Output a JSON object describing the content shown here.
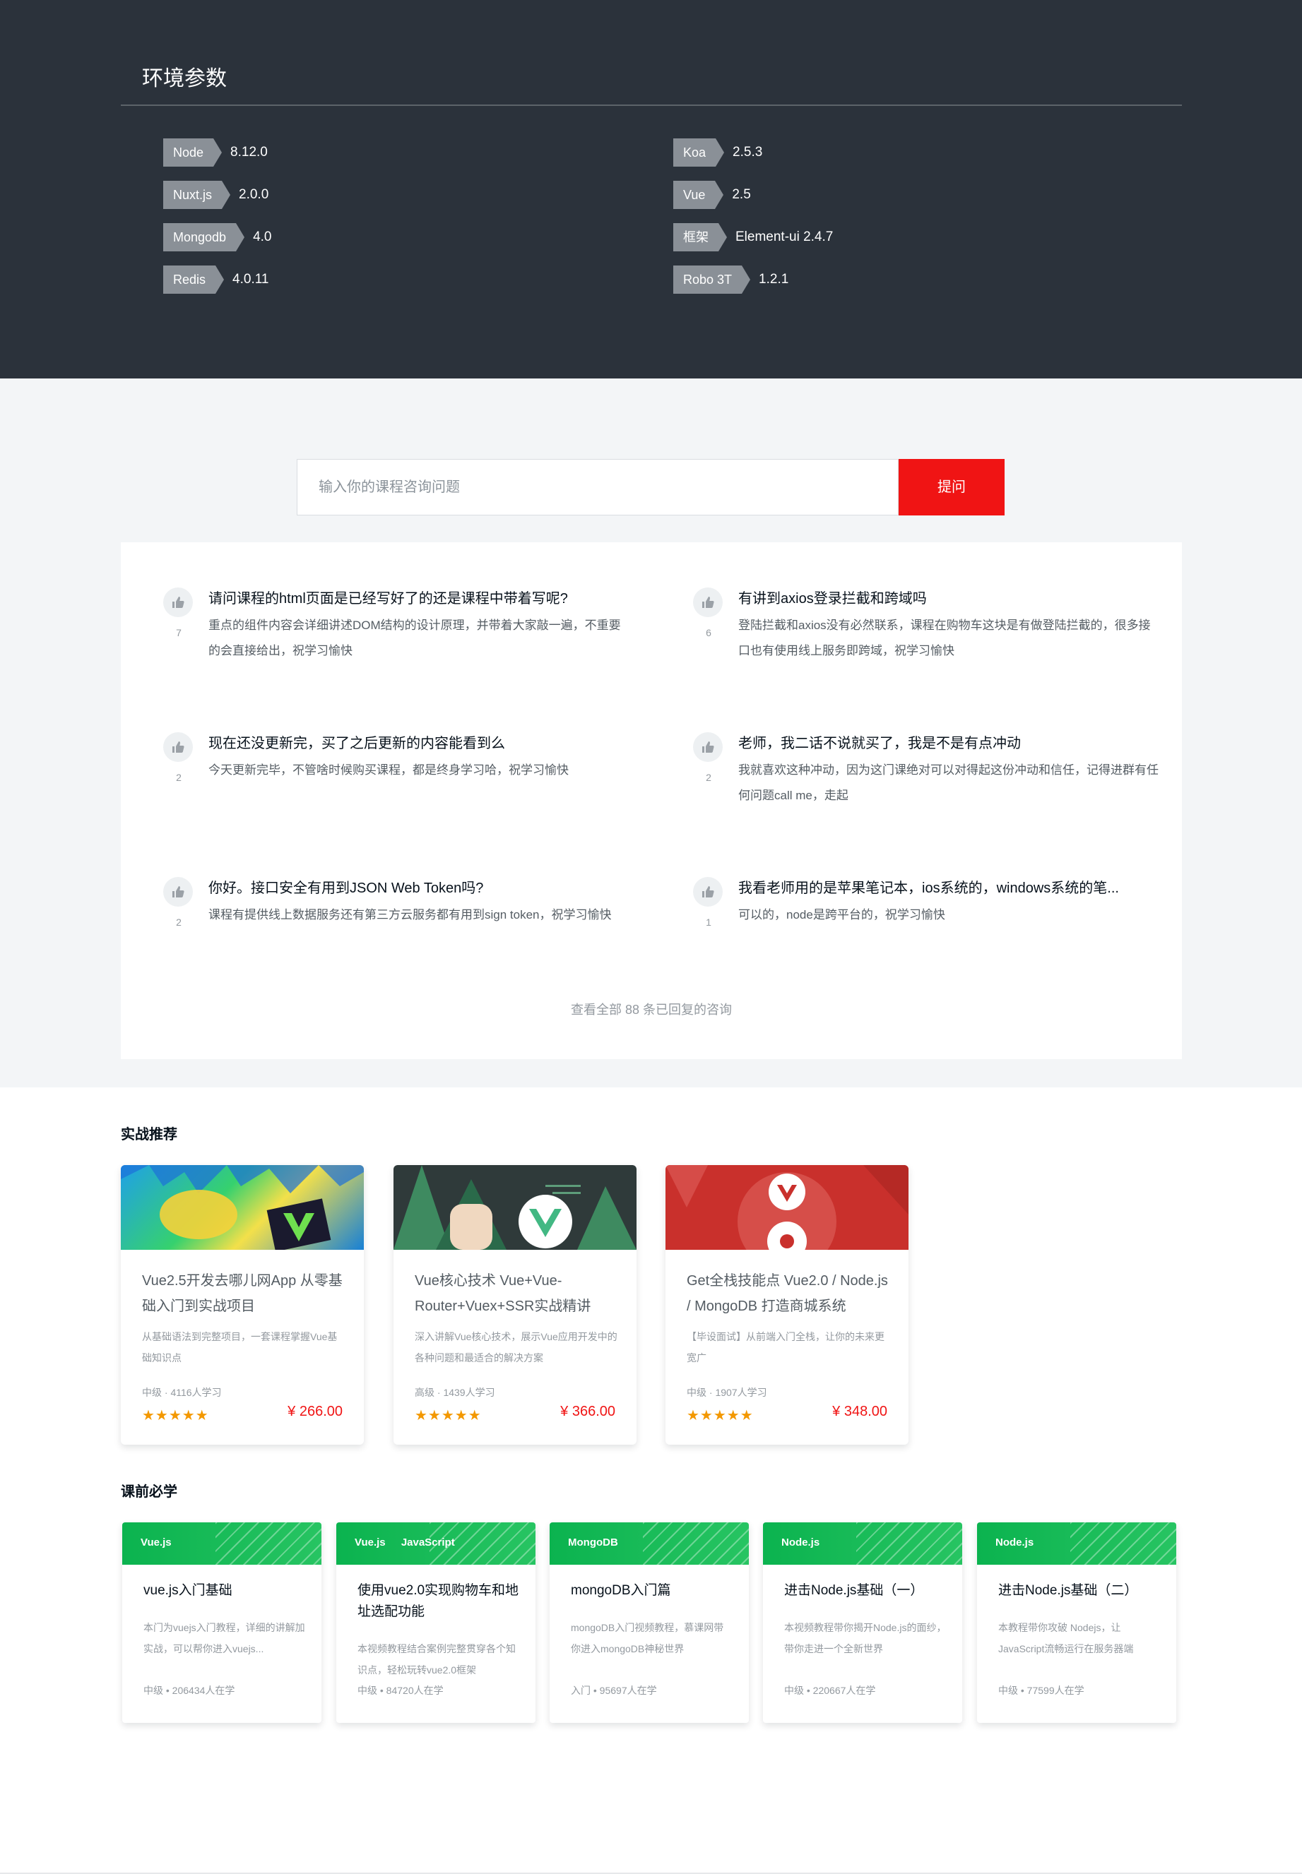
{
  "env": {
    "title": "环境参数",
    "left": [
      {
        "name": "Node",
        "value": "8.12.0"
      },
      {
        "name": "Nuxt.js",
        "value": "2.0.0"
      },
      {
        "name": "Mongodb",
        "value": "4.0"
      },
      {
        "name": "Redis",
        "value": "4.0.11"
      }
    ],
    "right": [
      {
        "name": "Koa",
        "value": "2.5.3"
      },
      {
        "name": "Vue",
        "value": "2.5"
      },
      {
        "name": "框架",
        "value": "Element-ui 2.4.7"
      },
      {
        "name": "Robo 3T",
        "value": "1.2.1"
      }
    ]
  },
  "ask": {
    "placeholder": "输入你的课程咨询问题",
    "button": "提问"
  },
  "qa": {
    "items": [
      {
        "likes": "7",
        "question": "请问课程的html页面是已经写好了的还是课程中带着写呢?",
        "answer": "重点的组件内容会详细讲述DOM结构的设计原理，并带着大家敲一遍，不重要的会直接给出，祝学习愉快"
      },
      {
        "likes": "6",
        "question": "有讲到axios登录拦截和跨域吗",
        "answer": "登陆拦截和axios没有必然联系，课程在购物车这块是有做登陆拦截的，很多接口也有使用线上服务即跨域，祝学习愉快"
      },
      {
        "likes": "2",
        "question": "现在还没更新完，买了之后更新的内容能看到么",
        "answer": "今天更新完毕，不管啥时候购买课程，都是终身学习哈，祝学习愉快"
      },
      {
        "likes": "2",
        "question": "老师，我二话不说就买了，我是不是有点冲动",
        "answer": "我就喜欢这种冲动，因为这门课绝对可以对得起这份冲动和信任，记得进群有任何问题call me，走起"
      },
      {
        "likes": "2",
        "question": "你好。接口安全有用到JSON Web Token吗?",
        "answer": "课程有提供线上数据服务还有第三方云服务都有用到sign token，祝学习愉快"
      },
      {
        "likes": "1",
        "question": "我看老师用的是苹果笔记本，ios系统的，windows系统的笔...",
        "answer": "可以的，node是跨平台的，祝学习愉快"
      }
    ],
    "more": "查看全部 88 条已回复的咨询"
  },
  "practice": {
    "title": "实战推荐",
    "courses": [
      {
        "title": "Vue2.5开发去哪儿网App 从零基础入门到实战项目",
        "desc": "从基础语法到完整项目，一套课程掌握Vue基础知识点",
        "meta": "中级 · 4116人学习",
        "stars": "★★★★★",
        "price": "¥ 266.00"
      },
      {
        "title": "Vue核心技术 Vue+Vue-Router+Vuex+SSR实战精讲",
        "desc": "深入讲解Vue核心技术，展示Vue应用开发中的各种问题和最适合的解决方案",
        "meta": "高级 · 1439人学习",
        "stars": "★★★★★",
        "price": "¥ 366.00"
      },
      {
        "title": "Get全栈技能点 Vue2.0 / Node.js / MongoDB 打造商城系统",
        "desc": "【毕设面试】从前端入门全栈，让你的未来更宽广",
        "meta": "中级 · 1907人学习",
        "stars": "★★★★★",
        "price": "¥ 348.00"
      }
    ]
  },
  "prereq": {
    "title": "课前必学",
    "courses": [
      {
        "tags": [
          "Vue.js"
        ],
        "title": "vue.js入门基础",
        "desc": "本门为vuejs入门教程，详细的讲解加实战，可以帮你进入vuejs...",
        "meta": "中级 • 206434人在学"
      },
      {
        "tags": [
          "Vue.js",
          "JavaScript"
        ],
        "title": "使用vue2.0实现购物车和地址选配功能",
        "desc": "本视频教程结合案例完整贯穿各个知识点，轻松玩转vue2.0框架",
        "meta": "中级 • 84720人在学"
      },
      {
        "tags": [
          "MongoDB"
        ],
        "title": "mongoDB入门篇",
        "desc": "mongoDB入门视频教程，慕课网带你进入mongoDB神秘世界",
        "meta": "入门 • 95697人在学"
      },
      {
        "tags": [
          "Node.js"
        ],
        "title": "进击Node.js基础（一）",
        "desc": "本视频教程带你揭开Node.js的面纱，带你走进一个全新世界",
        "meta": "中级 • 220667人在学"
      },
      {
        "tags": [
          "Node.js"
        ],
        "title": "进击Node.js基础（二）",
        "desc": "本教程带你攻破 Nodejs，让 JavaScript流畅运行在服务器端",
        "meta": "中级 • 77599人在学"
      }
    ]
  },
  "colors": {
    "env_bg": "#2b323b",
    "accent_red": "#f01414",
    "star": "#f39800",
    "green": "#0bb34f"
  }
}
